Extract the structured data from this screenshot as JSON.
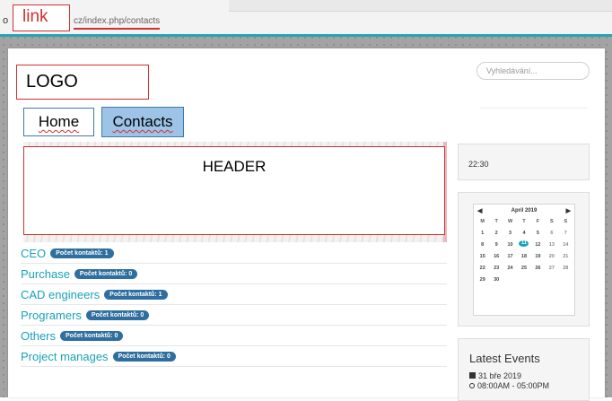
{
  "browser": {
    "left_glyph": "o",
    "link_label": "link",
    "url": "cz/index.php/contacts"
  },
  "site": {
    "logo": "LOGO",
    "search_placeholder": "Vyhledávání...",
    "nav": [
      {
        "label": "Home",
        "active": false
      },
      {
        "label": "Contacts",
        "active": true
      }
    ],
    "header_label": "HEADER"
  },
  "contacts": [
    {
      "label": "CEO",
      "badge": "Počet kontaktů: 1"
    },
    {
      "label": "Purchase",
      "badge": "Počet kontaktů: 0"
    },
    {
      "label": "CAD engineers",
      "badge": "Počet kontaktů: 1"
    },
    {
      "label": "Programers",
      "badge": "Počet kontaktů: 0"
    },
    {
      "label": "Others",
      "badge": "Počet kontaktů: 0"
    },
    {
      "label": "Project manages",
      "badge": "Počet kontaktů: 0"
    }
  ],
  "sidebar": {
    "time": "22:30",
    "calendar": {
      "month": "April 2019",
      "prev_icon": "◀",
      "next_icon": "▶",
      "weekdays": [
        "M",
        "T",
        "W",
        "T",
        "F",
        "S",
        "S"
      ],
      "weeks": [
        [
          "1",
          "2",
          "3",
          "4",
          "5",
          "6",
          "7"
        ],
        [
          "8",
          "9",
          "10",
          "11",
          "12",
          "13",
          "14"
        ],
        [
          "15",
          "16",
          "17",
          "18",
          "19",
          "20",
          "21"
        ],
        [
          "22",
          "23",
          "24",
          "25",
          "26",
          "27",
          "28"
        ],
        [
          "29",
          "30",
          "",
          "",
          "",
          "",
          ""
        ]
      ],
      "today": "11"
    },
    "events": {
      "title": "Latest Events",
      "date": "31 bře 2019",
      "time": "08:00AM - 05:00PM"
    }
  },
  "colors": {
    "accent": "#17a3b8",
    "badge": "#2f6f9f",
    "annotation_red": "#d32f2f",
    "nav_active_bg": "#9dc3e6"
  }
}
